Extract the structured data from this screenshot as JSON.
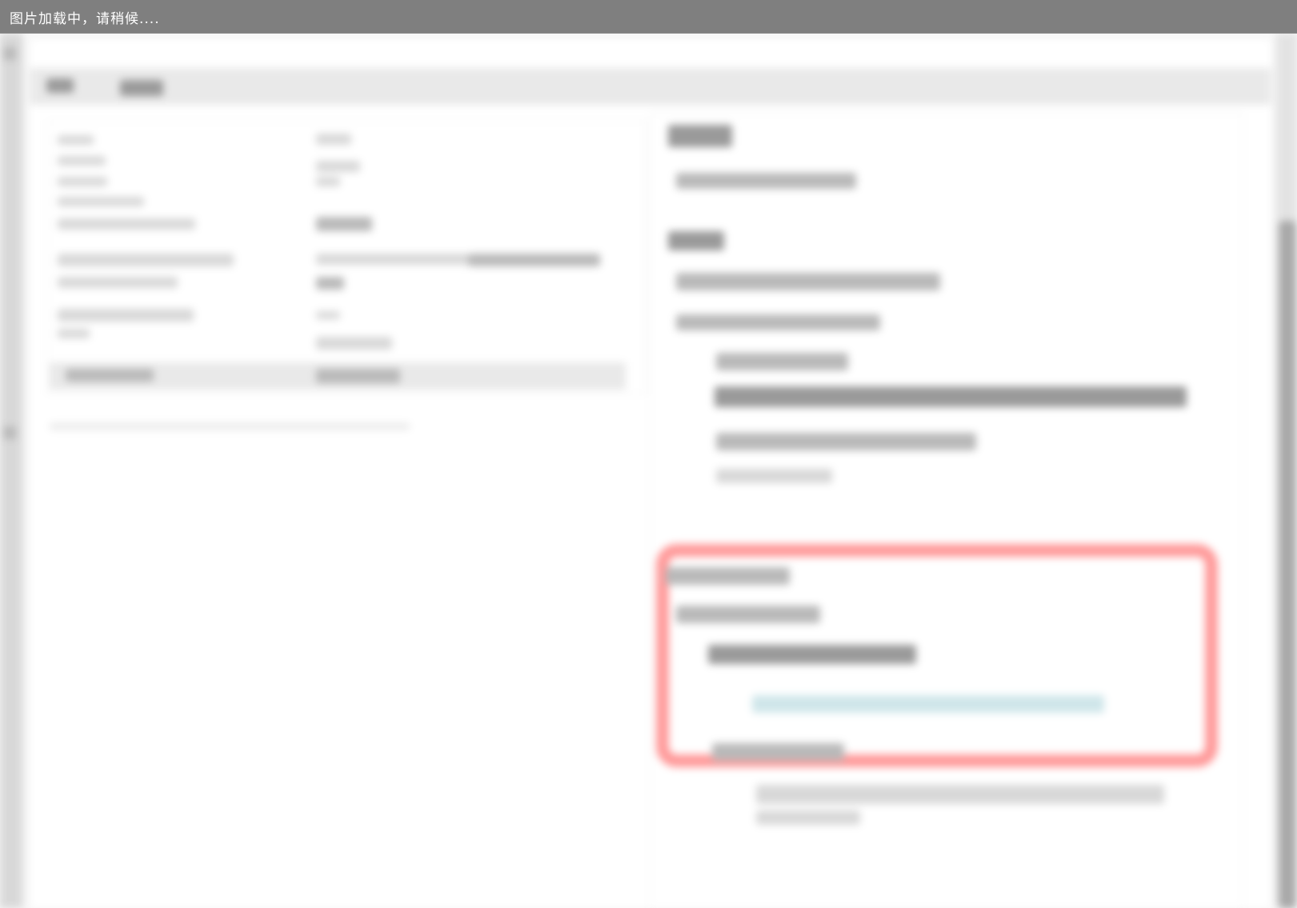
{
  "loading_bar": {
    "text": "图片加载中，请稍候...."
  }
}
